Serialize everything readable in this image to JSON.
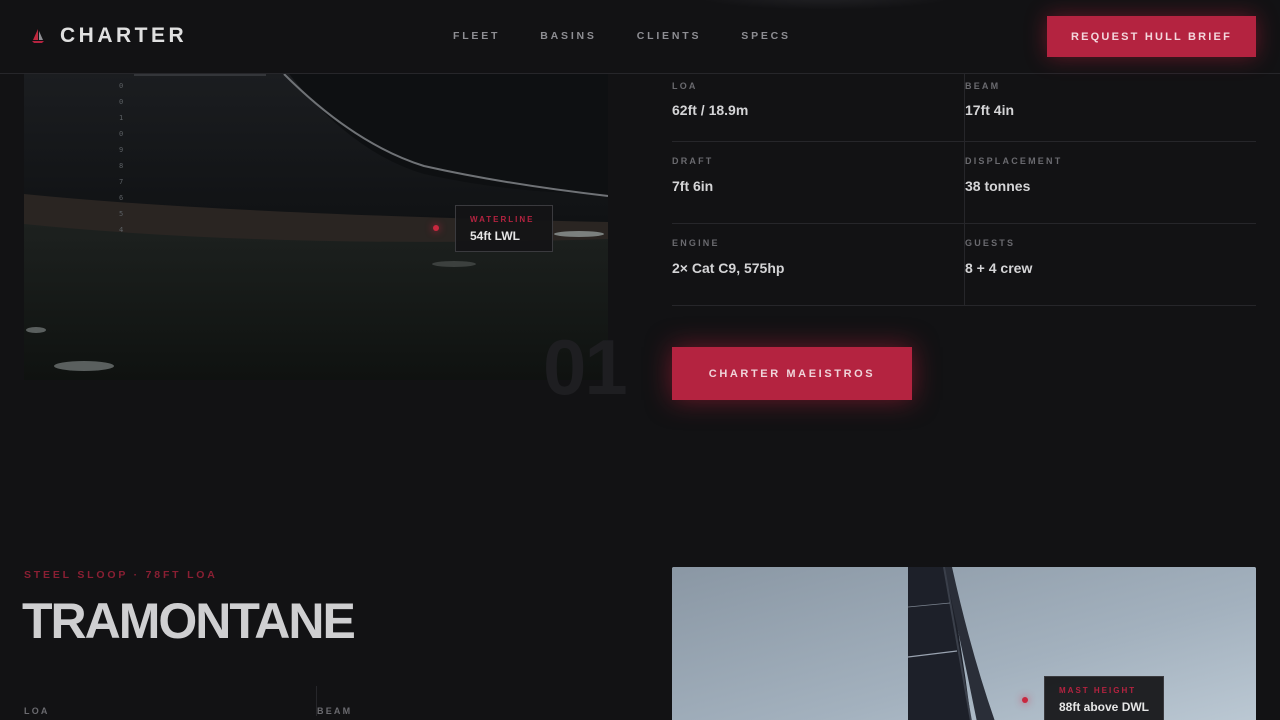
{
  "header": {
    "brand": "CHARTER",
    "nav": [
      "FLEET",
      "BASINS",
      "CLIENTS",
      "SPECS"
    ],
    "cta": "REQUEST HULL BRIEF"
  },
  "vessel1": {
    "index": "01",
    "waterline_marker": {
      "label": "WATERLINE",
      "value": "54ft LWL"
    },
    "specs": [
      {
        "label": "LOA",
        "value": "62ft / 18.9m"
      },
      {
        "label": "BEAM",
        "value": "17ft 4in"
      },
      {
        "label": "DRAFT",
        "value": "7ft 6in"
      },
      {
        "label": "DISPLACEMENT",
        "value": "38 tonnes"
      },
      {
        "label": "ENGINE",
        "value": "2× Cat C9, 575hp"
      },
      {
        "label": "GUESTS",
        "value": "8 + 4 crew"
      }
    ],
    "cta": "CHARTER MAEISTROS"
  },
  "vessel2": {
    "eyebrow": "STEEL SLOOP · 78FT LOA",
    "title": "TRAMONTANE",
    "spec_labels": [
      "LOA",
      "BEAM"
    ],
    "mast_marker": {
      "label": "MAST HEIGHT",
      "value": "88ft above DWL"
    }
  },
  "colors": {
    "accent": "#b42340",
    "background": "#121214"
  }
}
